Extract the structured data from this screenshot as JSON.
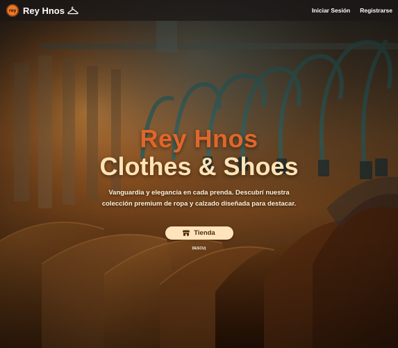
{
  "navbar": {
    "brand_name": "Rey Hnos",
    "logo_text": "rey",
    "links": [
      "Iniciar Sesión",
      "Registrarse"
    ]
  },
  "hero": {
    "title_line1": "Rey Hnos",
    "title_line2": "Clothes & Shoes",
    "description": "Vanguardia y elegancia en cada prenda. Descubrí nuestra colección premium de ropa y calzado diseñada para destacar.",
    "shop_button_label": "Tienda",
    "discover_label": "DESCU|"
  },
  "icons": {
    "brand": "hanger-icon",
    "shop_button": "store-icon"
  },
  "colors": {
    "accent_orange": "#e0662a",
    "cream": "#ffe3b5",
    "button_bg": "#ffe3ba",
    "navbar_bg": "#1c1816"
  }
}
